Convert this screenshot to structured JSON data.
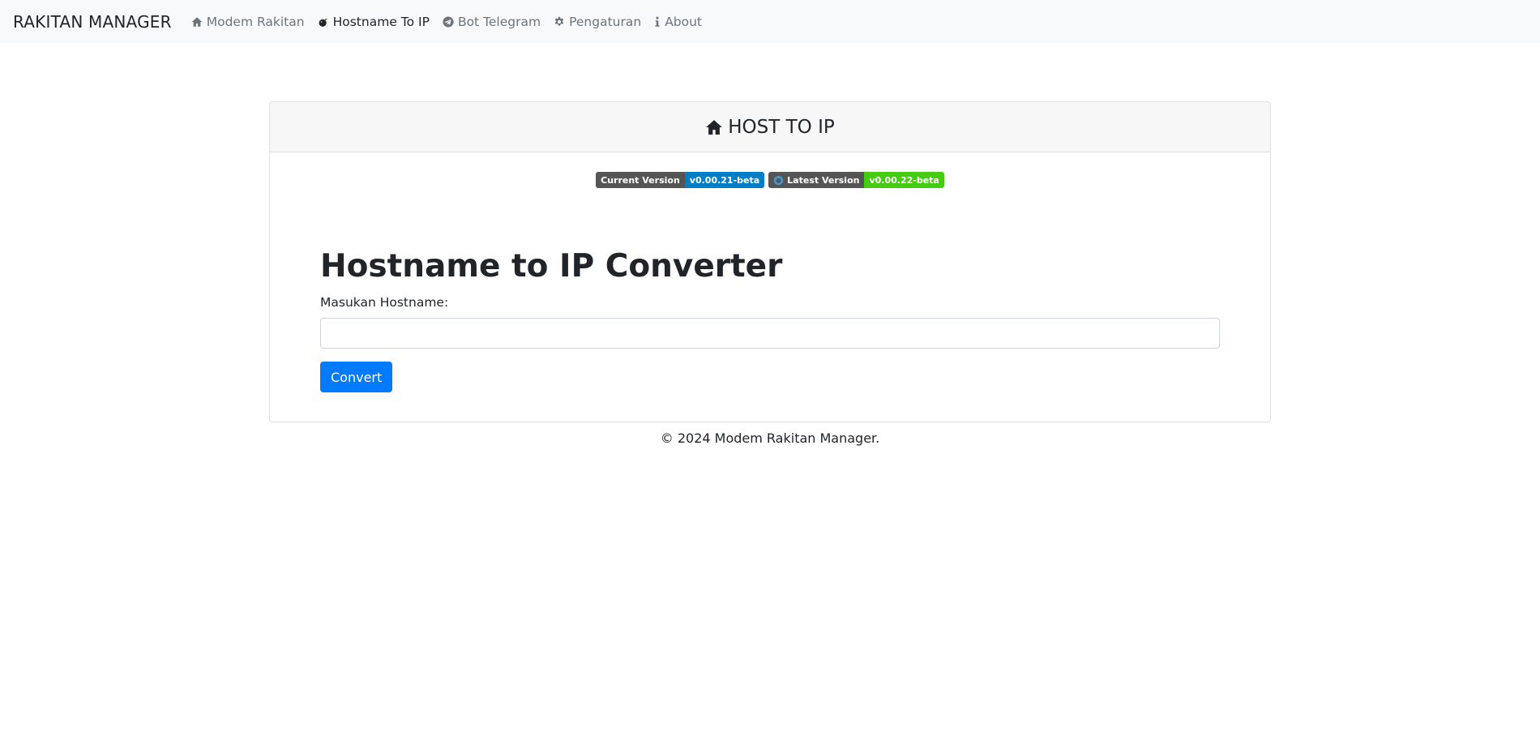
{
  "navbar": {
    "brand": "RAKITAN MANAGER",
    "items": [
      {
        "label": "Modem Rakitan",
        "icon": "home-icon",
        "active": false
      },
      {
        "label": "Hostname To IP",
        "icon": "bomb-icon",
        "active": true
      },
      {
        "label": "Bot Telegram",
        "icon": "telegram-icon",
        "active": false
      },
      {
        "label": "Pengaturan",
        "icon": "gear-icon",
        "active": false
      },
      {
        "label": "About",
        "icon": "info-icon",
        "active": false
      }
    ]
  },
  "card": {
    "header": "HOST TO IP",
    "header_icon": "home-icon",
    "badges": [
      {
        "label": "Current Version",
        "value": "v0.00.21-beta",
        "color": "#007ec6"
      },
      {
        "label": "Latest Version",
        "value": "v0.00.22-beta",
        "color": "#44cc11",
        "icon": "github-icon"
      }
    ],
    "title": "Hostname to IP Converter",
    "input_label": "Masukan Hostname:",
    "input_value": "",
    "button_label": "Convert"
  },
  "footer": "© 2024 Modem Rakitan Manager.",
  "colors": {
    "primary": "#007bff",
    "navbar_bg": "#f8f9fa",
    "badge_label_bg": "#555555"
  }
}
